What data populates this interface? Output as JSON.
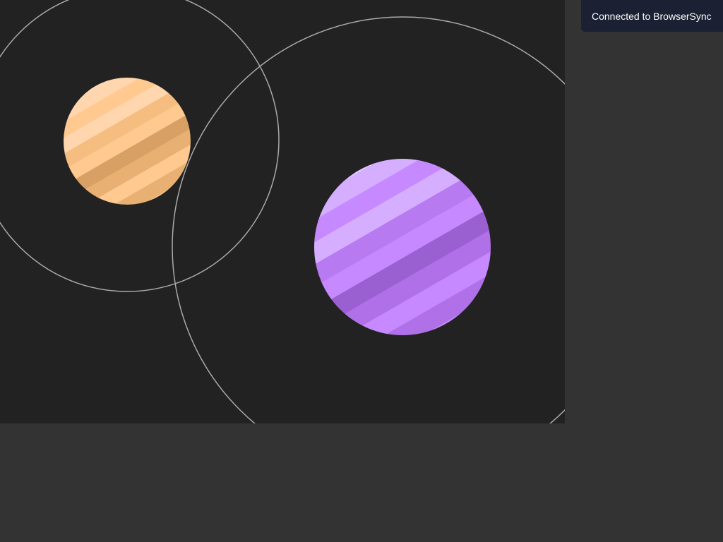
{
  "notification": {
    "text": "Connected to BrowserSync"
  },
  "colors": {
    "page_background": "#333333",
    "canvas_background": "#222222",
    "orbit_stroke": "#aaaaaa",
    "notification_background": "#1b2032",
    "notification_text": "#ffffff"
  },
  "planets": [
    {
      "name": "orange-planet",
      "stripe_colors": [
        "#ffe4c6",
        "#ffd6ae",
        "#ffc98f",
        "#ffd6ae",
        "#f5bd80",
        "#ffc98f",
        "#d9a065",
        "#e8b073",
        "#ffc98f",
        "#e8b073",
        "#f5c48d"
      ]
    },
    {
      "name": "purple-planet",
      "stripe_colors": [
        "#e3c8ff",
        "#d5aeff",
        "#c689ff",
        "#d5aeff",
        "#b77af0",
        "#c689ff",
        "#9a5fd0",
        "#b070e8",
        "#c689ff",
        "#b070e8",
        "#c08ef2"
      ]
    }
  ]
}
